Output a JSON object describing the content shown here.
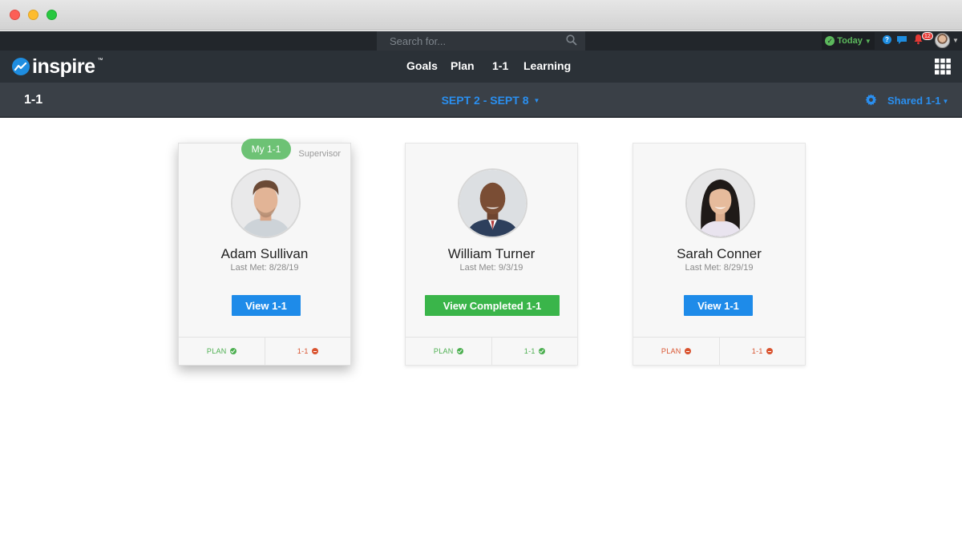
{
  "search": {
    "placeholder": "Search for..."
  },
  "topbar": {
    "today_label": "Today",
    "notifications_count": "12"
  },
  "brand": {
    "name": "inspire"
  },
  "nav": {
    "items": [
      "Goals",
      "Plan",
      "1-1",
      "Learning"
    ]
  },
  "subbar": {
    "page_title": "1-1",
    "date_range": "SEPT 2 - SEPT 8",
    "shared_label": "Shared 1-1"
  },
  "colors": {
    "accent_blue": "#1e8be9",
    "success_green": "#3ab54a",
    "badge_green": "#6dc275",
    "error_red": "#d9532f"
  },
  "cards": [
    {
      "badge": "My 1-1",
      "role": "Supervisor",
      "name": "Adam Sullivan",
      "last_met": "Last Met: 8/28/19",
      "button": "View 1-1",
      "plan_label": "PLAN",
      "plan_status": "complete",
      "oneone_label": "1-1",
      "oneone_status": "incomplete"
    },
    {
      "name": "William Turner",
      "last_met": "Last Met: 9/3/19",
      "button": "View Completed 1-1",
      "plan_label": "PLAN",
      "plan_status": "complete",
      "oneone_label": "1-1",
      "oneone_status": "complete"
    },
    {
      "name": "Sarah Conner",
      "last_met": "Last Met: 8/29/19",
      "button": "View 1-1",
      "plan_label": "PLAN",
      "plan_status": "incomplete",
      "oneone_label": "1-1",
      "oneone_status": "incomplete"
    }
  ]
}
